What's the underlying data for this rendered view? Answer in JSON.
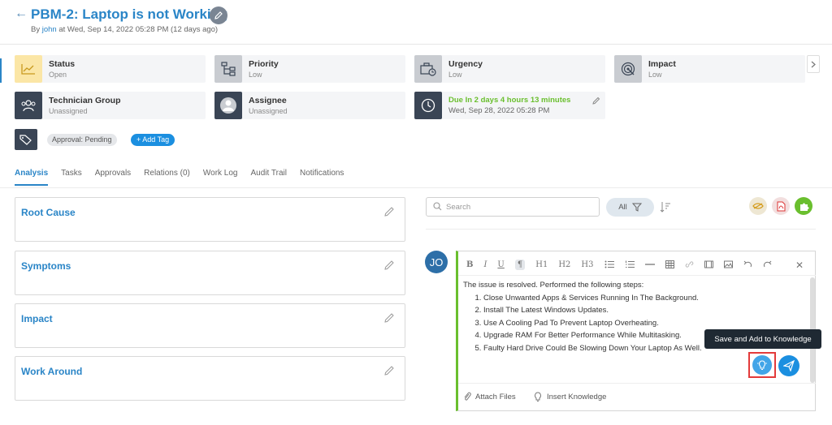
{
  "header": {
    "back_icon": "arrow-left-icon",
    "title": "PBM-2: Laptop is not Working",
    "by_prefix": "By",
    "author": "john",
    "date_text": "at Wed, Sep 14, 2022 05:28 PM (12 days ago)"
  },
  "cards": {
    "status": {
      "label": "Status",
      "value": "Open",
      "icon": "chart-line-icon"
    },
    "priority": {
      "label": "Priority",
      "value": "Low",
      "icon": "priority-flow-icon"
    },
    "urgency": {
      "label": "Urgency",
      "value": "Low",
      "icon": "briefcase-clock-icon"
    },
    "impact": {
      "label": "Impact",
      "value": "Low",
      "icon": "target-impact-icon"
    },
    "technician_group": {
      "label": "Technician Group",
      "value": "Unassigned",
      "icon": "group-icon"
    },
    "assignee": {
      "label": "Assignee",
      "value": "Unassigned",
      "icon": "user-avatar-icon"
    },
    "due": {
      "line1": "Due In 2 days 4 hours 13 minutes",
      "line2": "Wed, Sep 28, 2022 05:28 PM",
      "icon": "clock-icon"
    }
  },
  "tags": {
    "approval": "Approval: Pending",
    "add_tag": "+ Add Tag"
  },
  "tabs": [
    {
      "label": "Analysis",
      "active": true
    },
    {
      "label": "Tasks",
      "active": false
    },
    {
      "label": "Approvals",
      "active": false
    },
    {
      "label": "Relations (0)",
      "active": false
    },
    {
      "label": "Work Log",
      "active": false
    },
    {
      "label": "Audit Trail",
      "active": false
    },
    {
      "label": "Notifications",
      "active": false
    }
  ],
  "sections": {
    "root_cause": "Root Cause",
    "symptoms": "Symptoms",
    "impact": "Impact",
    "work_around": "Work Around"
  },
  "right_panel": {
    "search_placeholder": "Search",
    "filter_label": "All",
    "avatar_initials": "JO"
  },
  "editor": {
    "toolbar": [
      "B",
      "I",
      "U",
      "¶",
      "H1",
      "H2",
      "H3"
    ],
    "intro": "The issue is resolved. Performed the following steps:",
    "steps": [
      "Close Unwanted Apps & Services Running In The Background.",
      "Install The Latest Windows Updates.",
      "Use A Cooling Pad To Prevent Laptop Overheating.",
      "Upgrade RAM For Better Performance While Multitasking.",
      "Faulty Hard Drive Could Be Slowing Down Your Laptop As Well."
    ],
    "attach_files": "Attach Files",
    "insert_knowledge": "Insert Knowledge",
    "tooltip": "Save and Add to Knowledge"
  },
  "colors": {
    "accent": "#2a85c7",
    "dark_icon_bg": "#3a4555",
    "due_green": "#6abf2e",
    "highlight_red": "#e33b3b"
  }
}
